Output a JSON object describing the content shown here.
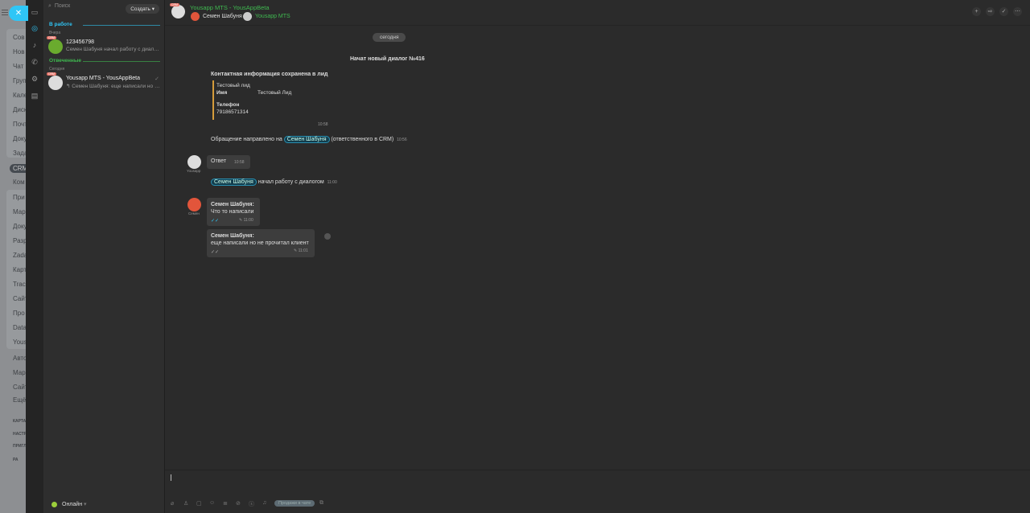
{
  "bitrix_menu": {
    "items": [
      "Сов",
      "Нов",
      "Чат",
      "Груп",
      "Кале",
      "Диск",
      "Почт",
      "Доку",
      "Зада",
      "CRM",
      "Ком",
      "При",
      "Мар",
      "Доку",
      "Разр",
      "Zada",
      "Карт",
      "Track",
      "Сайт",
      "Про",
      "Data",
      "Yous",
      "Авто",
      "Мар",
      "Сайт",
      "Ещё"
    ],
    "small": [
      "КАРТА",
      "НАСТР",
      "ПРИГЛ",
      "РА"
    ]
  },
  "search": {
    "placeholder": "Поиск",
    "create_label": "Создать"
  },
  "list": {
    "section_work": "В работе",
    "day_yesterday": "Вчера",
    "item1": {
      "tag": "CRM",
      "title": "123456798",
      "subtitle": "Семен Шабуня начал работу с диалогом"
    },
    "section_answered": "Отвеченные",
    "day_today": "Сегодня",
    "item2": {
      "tag": "CRM",
      "title": "Yousapp MTS - YousAppBeta",
      "subtitle": "↰ Семен Шабуня: еще написали но не прочитал клиент"
    }
  },
  "status": "Онлайн",
  "header": {
    "tag": "CRM",
    "title": "Yousapp MTS - YousAppBeta",
    "member1": "Семен Шабуня",
    "member2": "Yousapp MTS"
  },
  "chat": {
    "date": "сегодня",
    "started": "Начат новый диалог №416",
    "contact_title": "Контактная информация сохранена в лид",
    "lead_name": "Тестовый лид",
    "name_label": "Имя",
    "name_value": "Тестовый Лид",
    "phone_label": "Телефон",
    "phone_value": "79186571314",
    "contact_time": "10:58",
    "routed_prefix": "Обращение направлено на",
    "routed_user": "Семен Шабуня",
    "routed_suffix": "(ответственного в CRM)",
    "routed_time": "10:56",
    "bot_name": "Yousapp",
    "answer": "Ответ",
    "answer_time": "10:58",
    "started_user": "Семен Шабуня",
    "started_text": "начал работу с диалогом",
    "started_time": "11:00",
    "author_short": "Семен",
    "msg1": {
      "author": "Семен Шабуня:",
      "text": "Что то написали",
      "time": "11:00"
    },
    "msg2": {
      "author": "Семен Шабуня:",
      "text": "еще написали но не прочитал клиент",
      "time": "11:01"
    }
  },
  "toolbar": {
    "sales_label": "Продажи в чате"
  }
}
